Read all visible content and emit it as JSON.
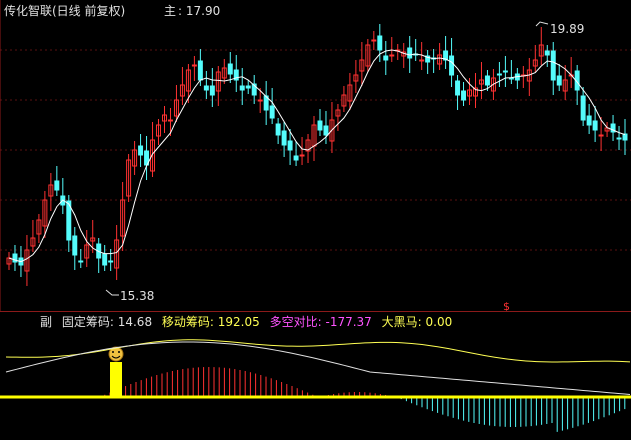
{
  "main": {
    "title": "传化智联(日线 前复权)",
    "price_label": "主",
    "price_value": "17.90",
    "high_marker": "19.89",
    "low_marker": "15.38",
    "marker_symbol": "$",
    "colors": {
      "up": "#ff3232",
      "down": "#54fcfc",
      "ma": "#ffffff",
      "grid": "#5a1010"
    }
  },
  "sub": {
    "label": "副",
    "indicators": [
      {
        "name": "固定筹码:",
        "value": "14.68",
        "color": "#e0e0e0"
      },
      {
        "name": "移动筹码:",
        "value": "192.05",
        "color": "#ffff54"
      },
      {
        "name": "多空对比:",
        "value": "-177.37",
        "color": "#ff54ff"
      },
      {
        "name": "大黑马:",
        "value": "0.00",
        "color": "#ffff54"
      }
    ],
    "colors": {
      "line1": "#ffff54",
      "line2": "#e0e0e0",
      "bar_pos": "#ff3232",
      "bar_neg": "#54fcfc",
      "zero": "#ffff00",
      "highlight": "#ffff00"
    }
  }
}
